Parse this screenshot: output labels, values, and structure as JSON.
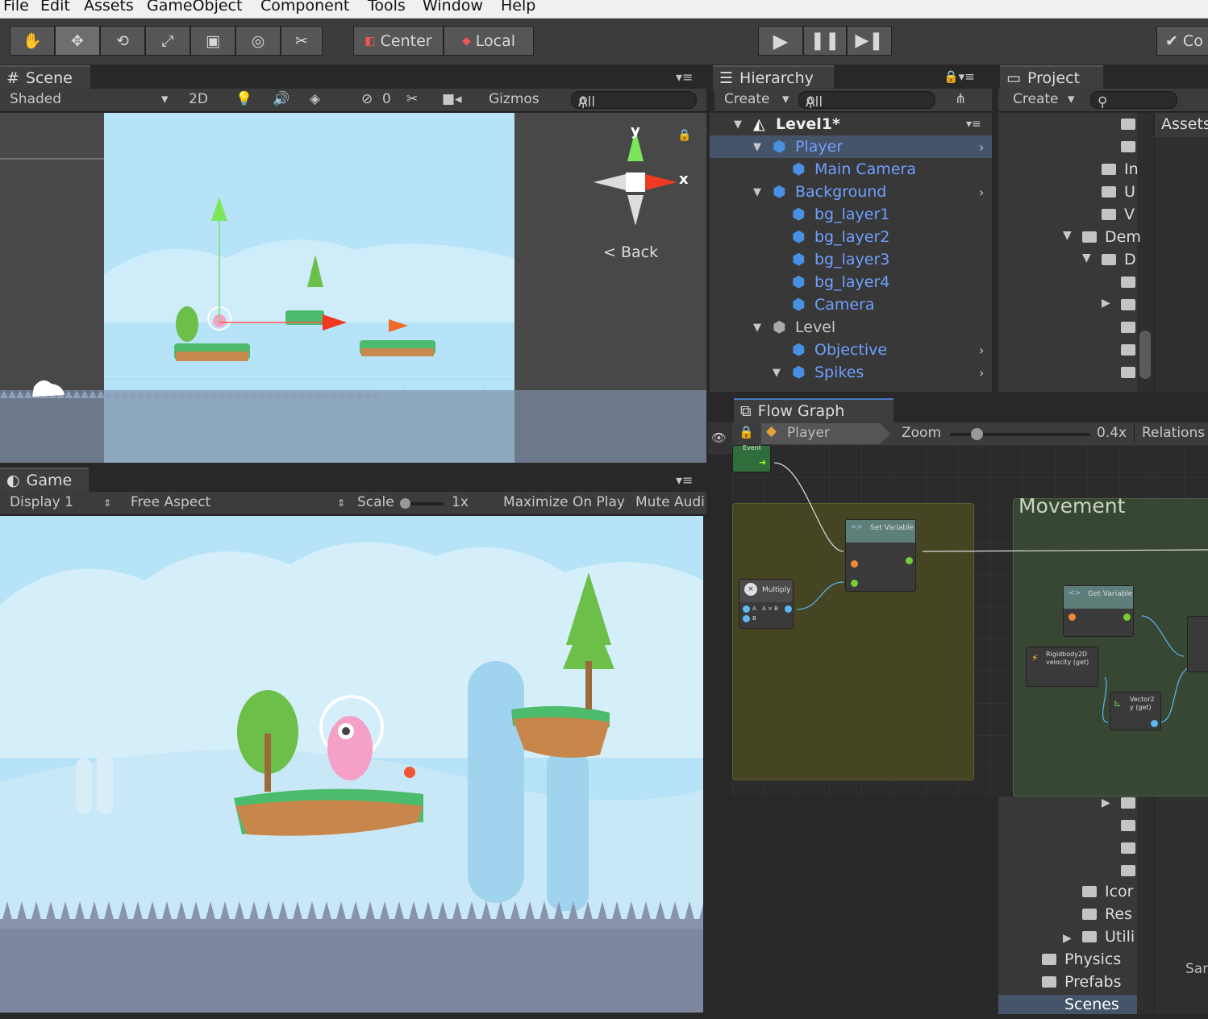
{
  "menu": [
    "File",
    "Edit",
    "Assets",
    "GameObject",
    "Component",
    "Tools",
    "Window",
    "Help"
  ],
  "toolbar": {
    "center": "Center",
    "local": "Local",
    "collab": "Co"
  },
  "scene": {
    "tab": "Scene",
    "shading": "Shaded",
    "mode2d": "2D",
    "hidden_count": "0",
    "gizmos": "Gizmos",
    "search": "All",
    "gizmo_y": "y",
    "gizmo_x": "x",
    "back": "Back"
  },
  "game": {
    "tab": "Game",
    "display": "Display 1",
    "aspect": "Free Aspect",
    "scale_label": "Scale",
    "scale_value": "1x",
    "maximize": "Maximize On Play",
    "mute": "Mute Audi"
  },
  "hierarchy": {
    "tab": "Hierarchy",
    "create": "Create",
    "search": "All",
    "items": [
      {
        "label": "Level1*",
        "depth": 0,
        "kind": "scene"
      },
      {
        "label": "Player",
        "depth": 1,
        "kind": "prefab"
      },
      {
        "label": "Main Camera",
        "depth": 2,
        "kind": "prefab"
      },
      {
        "label": "Background",
        "depth": 1,
        "kind": "prefab"
      },
      {
        "label": "bg_layer1",
        "depth": 2,
        "kind": "prefab"
      },
      {
        "label": "bg_layer2",
        "depth": 2,
        "kind": "prefab"
      },
      {
        "label": "bg_layer3",
        "depth": 2,
        "kind": "prefab"
      },
      {
        "label": "bg_layer4",
        "depth": 2,
        "kind": "prefab"
      },
      {
        "label": "Camera",
        "depth": 2,
        "kind": "prefab"
      },
      {
        "label": "Level",
        "depth": 1,
        "kind": "object"
      },
      {
        "label": "Objective",
        "depth": 2,
        "kind": "prefab"
      },
      {
        "label": "Spikes",
        "depth": 2,
        "kind": "prefab"
      }
    ]
  },
  "project": {
    "tab": "Project",
    "create": "Create",
    "assets": "Assets",
    "tree_partial": [
      "In",
      "U",
      "V",
      "Dem",
      "D"
    ],
    "tree_bottom": [
      "Icor",
      "Res",
      "Utili",
      "Physics",
      "Prefabs",
      "Scenes"
    ],
    "samples": "San"
  },
  "flow": {
    "tab": "Flow Graph",
    "target": "Player",
    "zoom_label": "Zoom",
    "zoom_value": "0.4x",
    "relations": "Relations",
    "group_title": "Movement",
    "nodes": {
      "event": "Event",
      "set_var": "Set Variable",
      "multiply": "Multiply",
      "multiply_ports": [
        "A",
        "A × B",
        "B"
      ],
      "get_var": "Get Variable",
      "rb": "Rigidbody2D\nvelocity (get)",
      "vec": "Vector2\ny (get)"
    }
  },
  "colors": {
    "sky": "#b6e3f7",
    "accent": "#6fa0ff",
    "selection": "#2d4d7a",
    "graph_bg": "#2b2b2b",
    "group_yellow": "#4a4a22",
    "group_green": "#3a4a36"
  }
}
